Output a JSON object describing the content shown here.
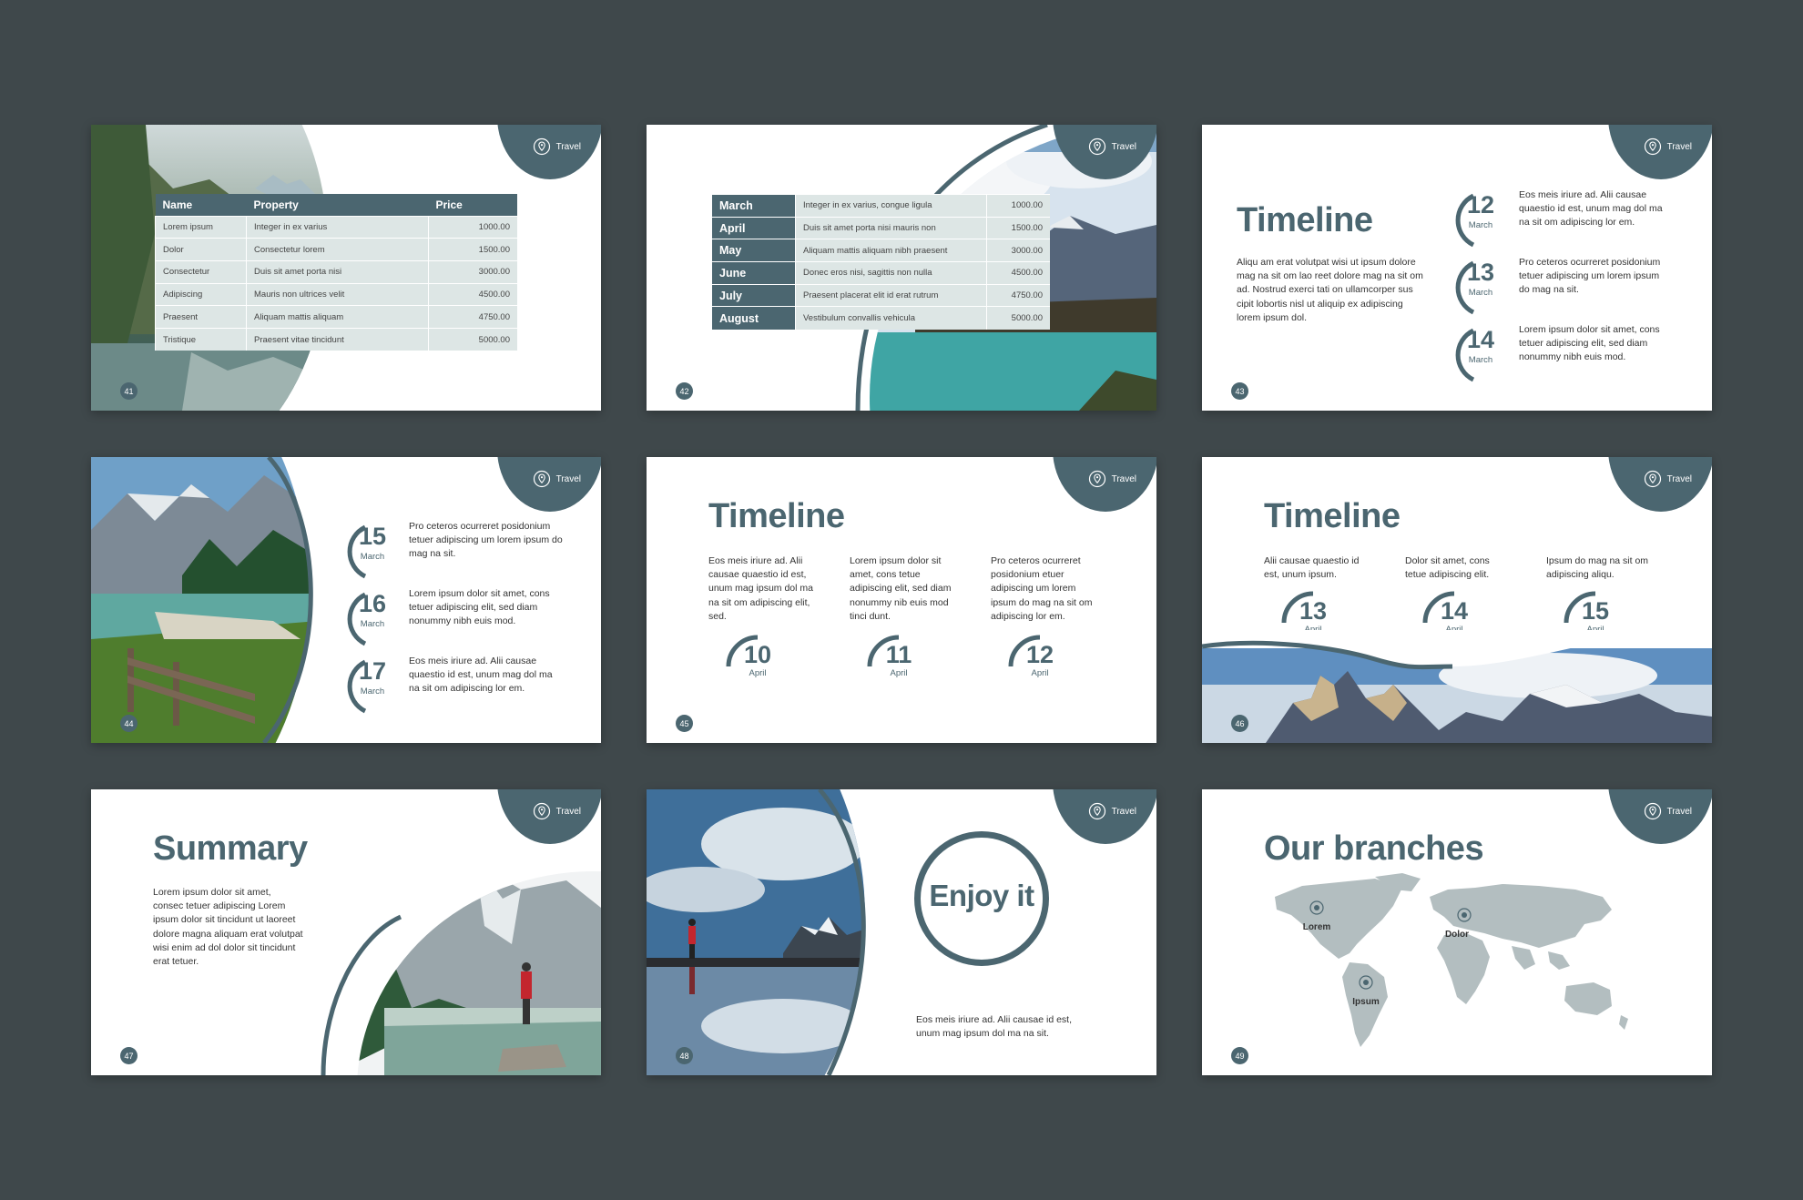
{
  "brand": {
    "tag": "Travel",
    "accent": "#4b6670",
    "background": "#3f484b",
    "cell": "#dde6e5"
  },
  "slides": [
    {
      "page": "41",
      "table": {
        "headers": [
          "Name",
          "Property",
          "Price"
        ],
        "rows": [
          [
            "Lorem ipsum",
            "Integer in ex varius",
            "1000.00"
          ],
          [
            "Dolor",
            "Consectetur lorem",
            "1500.00"
          ],
          [
            "Consectetur",
            "Duis sit amet porta nisi",
            "3000.00"
          ],
          [
            "Adipiscing",
            "Mauris non ultrices velit",
            "4500.00"
          ],
          [
            "Praesent",
            "Aliquam mattis aliquam",
            "4750.00"
          ],
          [
            "Tristique",
            "Praesent vitae tincidunt",
            "5000.00"
          ]
        ]
      }
    },
    {
      "page": "42",
      "table": {
        "rows": [
          [
            "March",
            "Integer in ex varius, congue ligula",
            "1000.00"
          ],
          [
            "April",
            "Duis sit amet porta nisi mauris non",
            "1500.00"
          ],
          [
            "May",
            "Aliquam mattis aliquam nibh praesent",
            "3000.00"
          ],
          [
            "June",
            "Donec eros nisi, sagittis non nulla",
            "4500.00"
          ],
          [
            "July",
            "Praesent placerat elit id erat rutrum",
            "4750.00"
          ],
          [
            "August",
            "Vestibulum convallis vehicula",
            "5000.00"
          ]
        ]
      }
    },
    {
      "page": "43",
      "title": "Timeline",
      "body": "Aliqu am erat volutpat wisi ut ipsum dolore mag na sit om lao reet dolore mag na sit om ad. Nostrud exerci tati on ullamcorper sus cipit lobortis nisl ut aliquip ex adipiscing lorem ipsum dol.",
      "items": [
        {
          "num": "12",
          "month": "March",
          "text": "Eos meis iriure ad. Alii causae quaestio id est, unum mag dol ma na sit om adipiscing lor em."
        },
        {
          "num": "13",
          "month": "March",
          "text": "Pro ceteros ocurreret posidonium tetuer adipiscing um lorem ipsum do mag na sit."
        },
        {
          "num": "14",
          "month": "March",
          "text": "Lorem ipsum dolor sit amet, cons tetuer adipiscing elit, sed diam nonummy nibh euis mod."
        }
      ]
    },
    {
      "page": "44",
      "items": [
        {
          "num": "15",
          "month": "March",
          "text": "Pro ceteros ocurreret posidonium tetuer adipiscing um lorem ipsum do mag na sit."
        },
        {
          "num": "16",
          "month": "March",
          "text": "Lorem ipsum dolor sit amet, cons tetuer adipiscing elit, sed diam nonummy nibh euis mod."
        },
        {
          "num": "17",
          "month": "March",
          "text": "Eos meis iriure ad. Alii causae quaestio id est, unum mag dol ma na sit om adipiscing lor em."
        }
      ]
    },
    {
      "page": "45",
      "title": "Timeline",
      "items": [
        {
          "num": "10",
          "month": "April",
          "text": "Eos meis iriure ad. Alii causae quaestio id est, unum mag ipsum dol ma na sit om adipiscing elit, sed."
        },
        {
          "num": "11",
          "month": "April",
          "text": "Lorem ipsum dolor sit amet, cons tetue adipiscing elit, sed diam nonummy nib euis mod tinci dunt."
        },
        {
          "num": "12",
          "month": "April",
          "text": "Pro ceteros ocurreret posidonium etuer adipiscing um lorem ipsum do mag na sit om adipiscing lor em."
        }
      ]
    },
    {
      "page": "46",
      "title": "Timeline",
      "items": [
        {
          "num": "13",
          "month": "April",
          "text": "Alii causae quaestio id est, unum ipsum."
        },
        {
          "num": "14",
          "month": "April",
          "text": "Dolor sit amet, cons tetue adipiscing elit."
        },
        {
          "num": "15",
          "month": "April",
          "text": "Ipsum do mag na sit om adipiscing aliqu."
        }
      ]
    },
    {
      "page": "47",
      "title": "Summary",
      "body": "Lorem ipsum dolor sit amet, consec tetuer adipiscing Lorem ipsum dolor sit tincidunt ut laoreet dolore magna aliquam erat volutpat wisi enim ad dol dolor sit tincidunt erat tetuer."
    },
    {
      "page": "48",
      "title": "Enjoy it",
      "body": "Eos meis iriure ad. Alii causae id est, unum mag ipsum dol ma na sit."
    },
    {
      "page": "49",
      "title": "Our branches",
      "pins": [
        "Lorem",
        "Dolor",
        "Ipsum"
      ]
    }
  ]
}
